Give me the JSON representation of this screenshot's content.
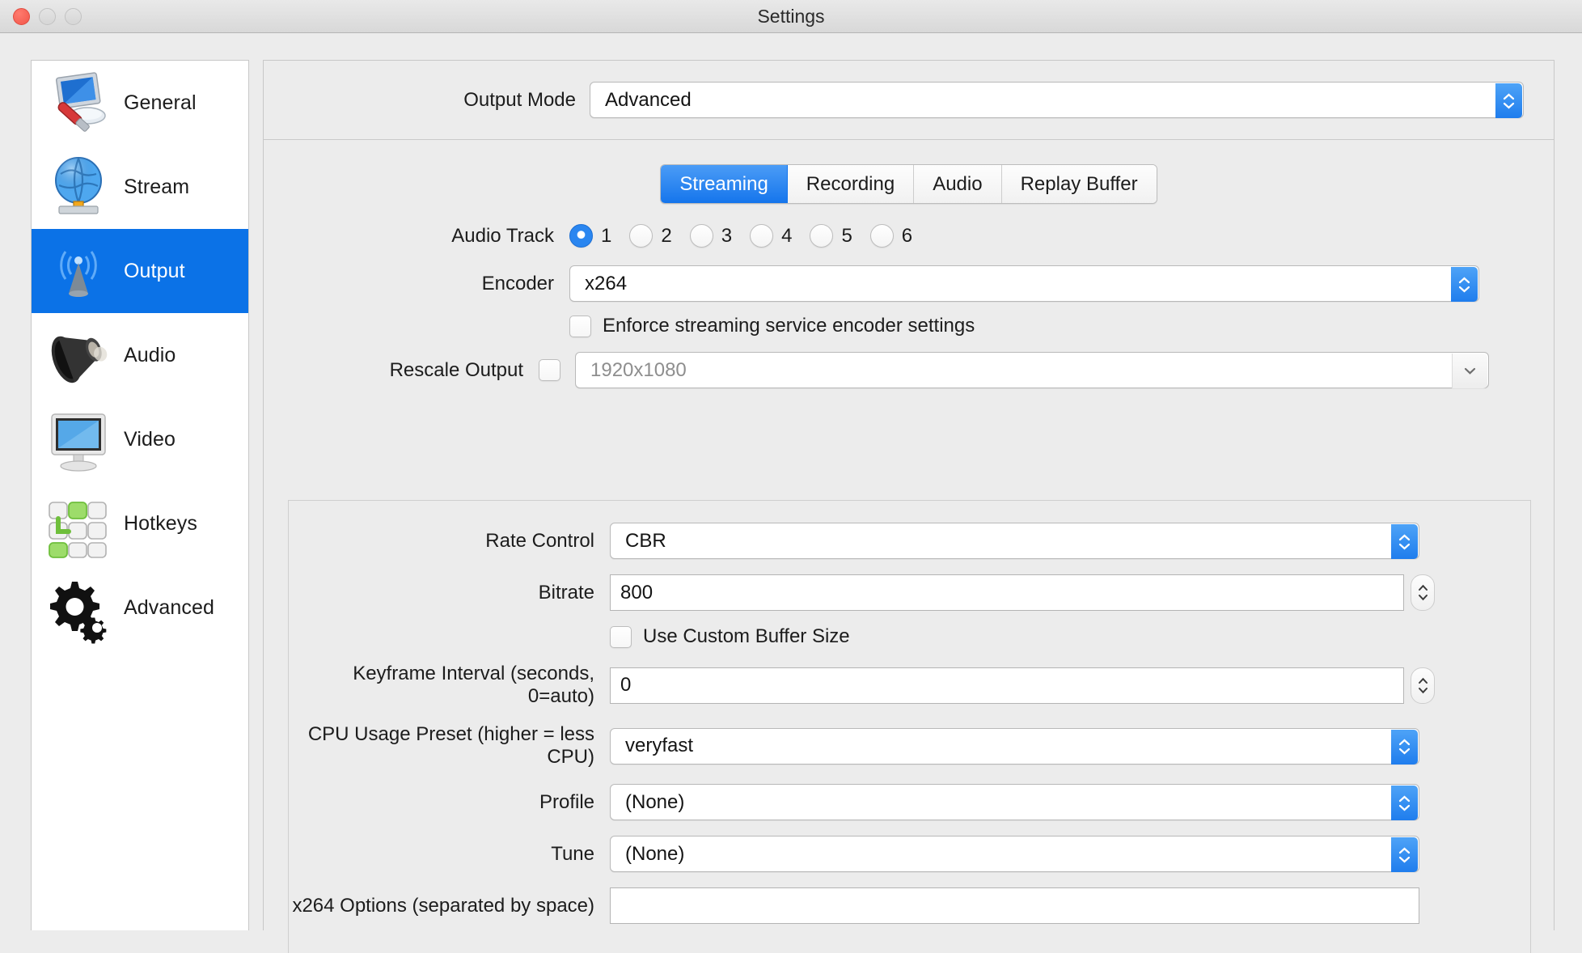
{
  "window": {
    "title": "Settings",
    "traffic_lights": [
      "close-red",
      "minimize-grey",
      "zoom-grey"
    ]
  },
  "sidebar": {
    "items": [
      {
        "label": "General",
        "icon": "general-icon",
        "active": false
      },
      {
        "label": "Stream",
        "icon": "stream-icon",
        "active": false
      },
      {
        "label": "Output",
        "icon": "output-icon",
        "active": true
      },
      {
        "label": "Audio",
        "icon": "audio-icon",
        "active": false
      },
      {
        "label": "Video",
        "icon": "video-icon",
        "active": false
      },
      {
        "label": "Hotkeys",
        "icon": "hotkeys-icon",
        "active": false
      },
      {
        "label": "Advanced",
        "icon": "advanced-icon",
        "active": false
      }
    ]
  },
  "output_mode": {
    "label": "Output Mode",
    "value": "Advanced"
  },
  "tabs": [
    {
      "label": "Streaming",
      "active": true
    },
    {
      "label": "Recording",
      "active": false
    },
    {
      "label": "Audio",
      "active": false
    },
    {
      "label": "Replay Buffer",
      "active": false
    }
  ],
  "streaming": {
    "audio_track": {
      "label": "Audio Track",
      "options": [
        "1",
        "2",
        "3",
        "4",
        "5",
        "6"
      ],
      "selected": "1"
    },
    "encoder": {
      "label": "Encoder",
      "value": "x264"
    },
    "enforce": {
      "label": "Enforce streaming service encoder settings",
      "checked": false
    },
    "rescale_output": {
      "label": "Rescale Output",
      "checked": false,
      "value": "1920x1080",
      "disabled": true
    },
    "rate_control": {
      "label": "Rate Control",
      "value": "CBR"
    },
    "bitrate": {
      "label": "Bitrate",
      "value": "800"
    },
    "custom_buffer": {
      "label": "Use Custom Buffer Size",
      "checked": false
    },
    "keyframe_interval": {
      "label": "Keyframe Interval (seconds, 0=auto)",
      "value": "0"
    },
    "cpu_preset": {
      "label": "CPU Usage Preset (higher = less CPU)",
      "value": "veryfast"
    },
    "profile": {
      "label": "Profile",
      "value": "(None)"
    },
    "tune": {
      "label": "Tune",
      "value": "(None)"
    },
    "x264_options": {
      "label": "x264 Options (separated by space)",
      "value": ""
    }
  },
  "colors": {
    "accent_blue": "#0b72e7",
    "tab_active": "#1575ec",
    "window_bg": "#ececec",
    "close_red": "#f2564a"
  }
}
